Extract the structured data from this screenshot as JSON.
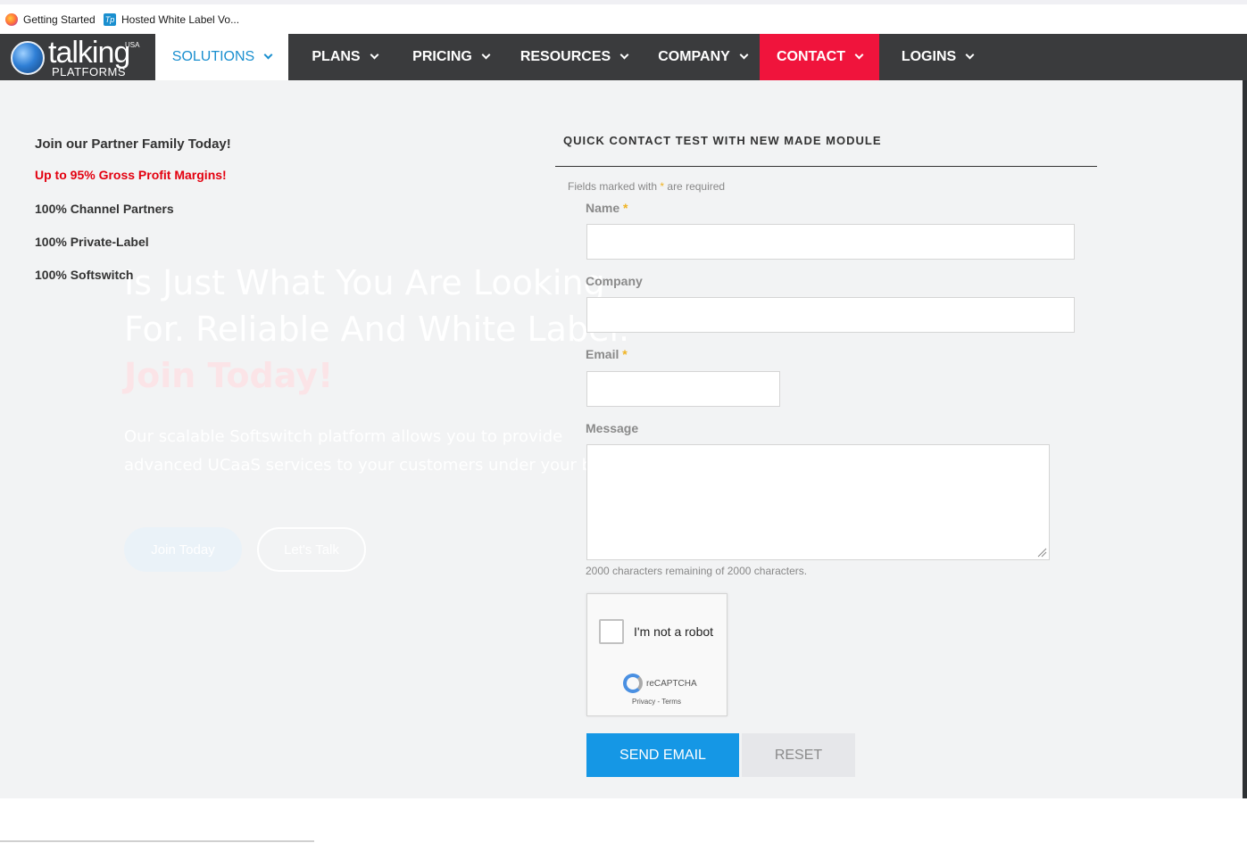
{
  "bookmarks": [
    {
      "label": "Getting Started",
      "icon": "firefox-icon"
    },
    {
      "label": "Hosted White Label Vo...",
      "icon": "talking-platforms-icon"
    }
  ],
  "logo": {
    "main": "talking",
    "sub": "PLATFORMS",
    "tag": "USA"
  },
  "nav": {
    "solutions": "SOLUTIONS",
    "plans": "PLANS",
    "pricing": "PRICING",
    "resources": "RESOURCES",
    "company": "COMPANY",
    "contact": "CONTACT",
    "logins": "LOGINS"
  },
  "hero_bg": {
    "line1": "Is Just What You Are Looking",
    "line2": "For. Reliable And White Label.",
    "line3": "Join Today!",
    "para1": "Our scalable Softswitch platform allows you to provide",
    "para2": "advanced UCaaS services to your customers under your bra",
    "btn1": "Join Today",
    "btn2": "Let's Talk"
  },
  "partner": {
    "title": "Join our Partner Family Today!",
    "highlight": "Up to 95% Gross Profit Margins!",
    "items": [
      "100% Channel Partners",
      "100% Private-Label",
      "100% Softswitch"
    ]
  },
  "form": {
    "title": "QUICK CONTACT TEST WITH NEW MADE MODULE",
    "required_prefix": "Fields marked with",
    "required_suffix": "are required",
    "star": "*",
    "name_label": "Name",
    "company_label": "Company",
    "email_label": "Email",
    "message_label": "Message",
    "name_value": "",
    "company_value": "",
    "email_value": "",
    "message_value": "",
    "counter": "2000 characters remaining of 2000 characters.",
    "captcha_label": "I'm not a robot",
    "captcha_brand": "reCAPTCHA",
    "captcha_links": "Privacy - Terms",
    "send": "SEND EMAIL",
    "reset": "RESET"
  },
  "colors": {
    "nav_bg": "#3a3b3d",
    "contact_red": "#f0143c",
    "solutions_blue": "#1a8fcf",
    "send_blue": "#1597e5",
    "highlight_red": "#e3000f",
    "required_star": "#f0b323"
  }
}
